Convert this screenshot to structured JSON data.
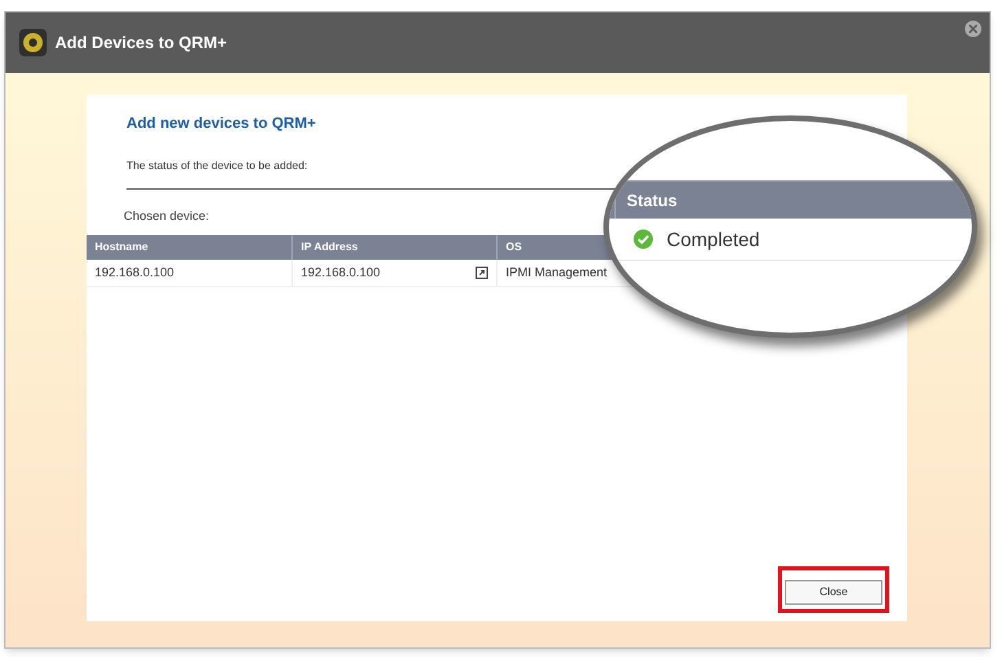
{
  "window": {
    "title": "Add Devices to QRM+"
  },
  "heading": "Add new devices to QRM+",
  "subtitle": "The status of the device to be added:",
  "chosen_label": "Chosen device:",
  "table": {
    "columns": [
      "Hostname",
      "IP Address",
      "OS"
    ],
    "rows": [
      {
        "cells": [
          "192.168.0.100",
          "192.168.0.100",
          "IPMI Management"
        ]
      }
    ]
  },
  "magnifier": {
    "column": "Status",
    "value": "Completed",
    "completed": true
  },
  "close_button": {
    "label": "Close",
    "highlighted": true
  }
}
